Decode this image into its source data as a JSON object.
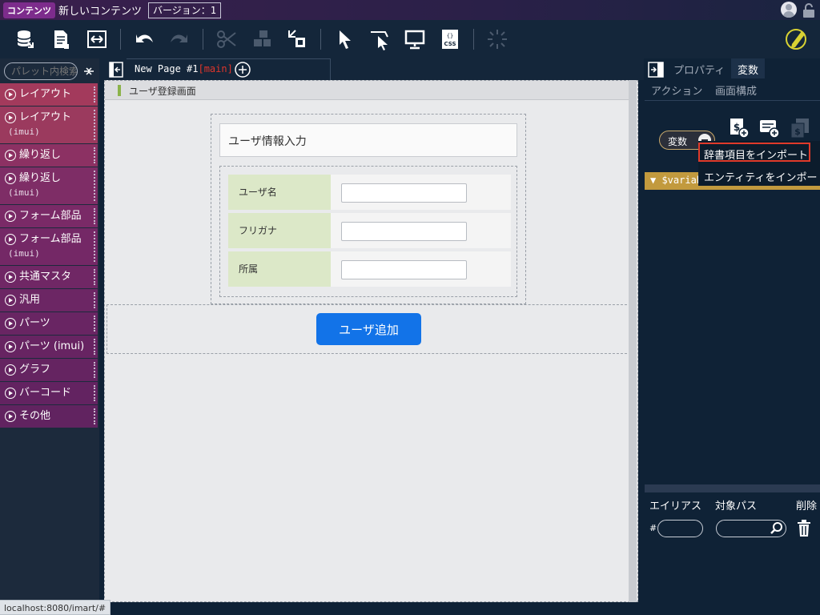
{
  "topbar": {
    "badge": "コンテンツ",
    "content_name": "新しいコンテンツ",
    "version": "バージョン：1"
  },
  "toolbar": {
    "icons": [
      "database-icon",
      "document-icon",
      "swap-icon",
      "undo-icon",
      "redo-icon",
      "cut-icon",
      "copy-icon",
      "paste-icon",
      "pointer-icon",
      "select-icon",
      "preview-icon",
      "css-icon",
      "spinner-icon",
      "edit-icon"
    ]
  },
  "palette": {
    "search_placeholder": "パレット内検索",
    "items": [
      {
        "label": "レイアウト",
        "sub": "",
        "color": "#a33a5c"
      },
      {
        "label": "レイアウト",
        "sub": "(imui)",
        "color": "#9b3a5e"
      },
      {
        "label": "繰り返し",
        "sub": "",
        "color": "#8c3163"
      },
      {
        "label": "繰り返し",
        "sub": "(imui)",
        "color": "#7e2d66"
      },
      {
        "label": "フォーム部品",
        "sub": "",
        "color": "#7a2a67"
      },
      {
        "label": "フォーム部品",
        "sub": "(imui)",
        "color": "#742866"
      },
      {
        "label": "共通マスタ",
        "sub": "",
        "color": "#702765"
      },
      {
        "label": "汎用",
        "sub": "",
        "color": "#6c2664"
      },
      {
        "label": "パーツ",
        "sub": "",
        "color": "#692563"
      },
      {
        "label": "パーツ (imui)",
        "sub": "",
        "color": "#672462"
      },
      {
        "label": "グラフ",
        "sub": "",
        "color": "#652461"
      },
      {
        "label": "バーコード",
        "sub": "",
        "color": "#632361"
      },
      {
        "label": "その他",
        "sub": "",
        "color": "#612360"
      }
    ]
  },
  "tabs": {
    "page_name": "New Page #1",
    "branch": "[main]"
  },
  "canvas": {
    "screen_title": "ユーザ登録画面",
    "form_header": "ユーザ情報入力",
    "rows": [
      {
        "label": "ユーザ名",
        "value": ""
      },
      {
        "label": "フリガナ",
        "value": ""
      },
      {
        "label": "所属",
        "value": ""
      }
    ],
    "button_label": "ユーザ追加"
  },
  "right_panel": {
    "tabs": [
      "プロパティ",
      "変数",
      "アクション",
      "画面構成"
    ],
    "active_tab": "変数",
    "var_pill": "変数",
    "var_bar": "▼ $variab",
    "columns": {
      "alias": "エイリアス",
      "path": "対象パス",
      "delete": "削除"
    },
    "hash": "#",
    "alias_value": "",
    "path_value": ""
  },
  "context_menu": {
    "items": [
      "辞書項目をインポート",
      "エンティティをインポート"
    ]
  },
  "status": {
    "url": "localhost:8080/imart/#"
  }
}
